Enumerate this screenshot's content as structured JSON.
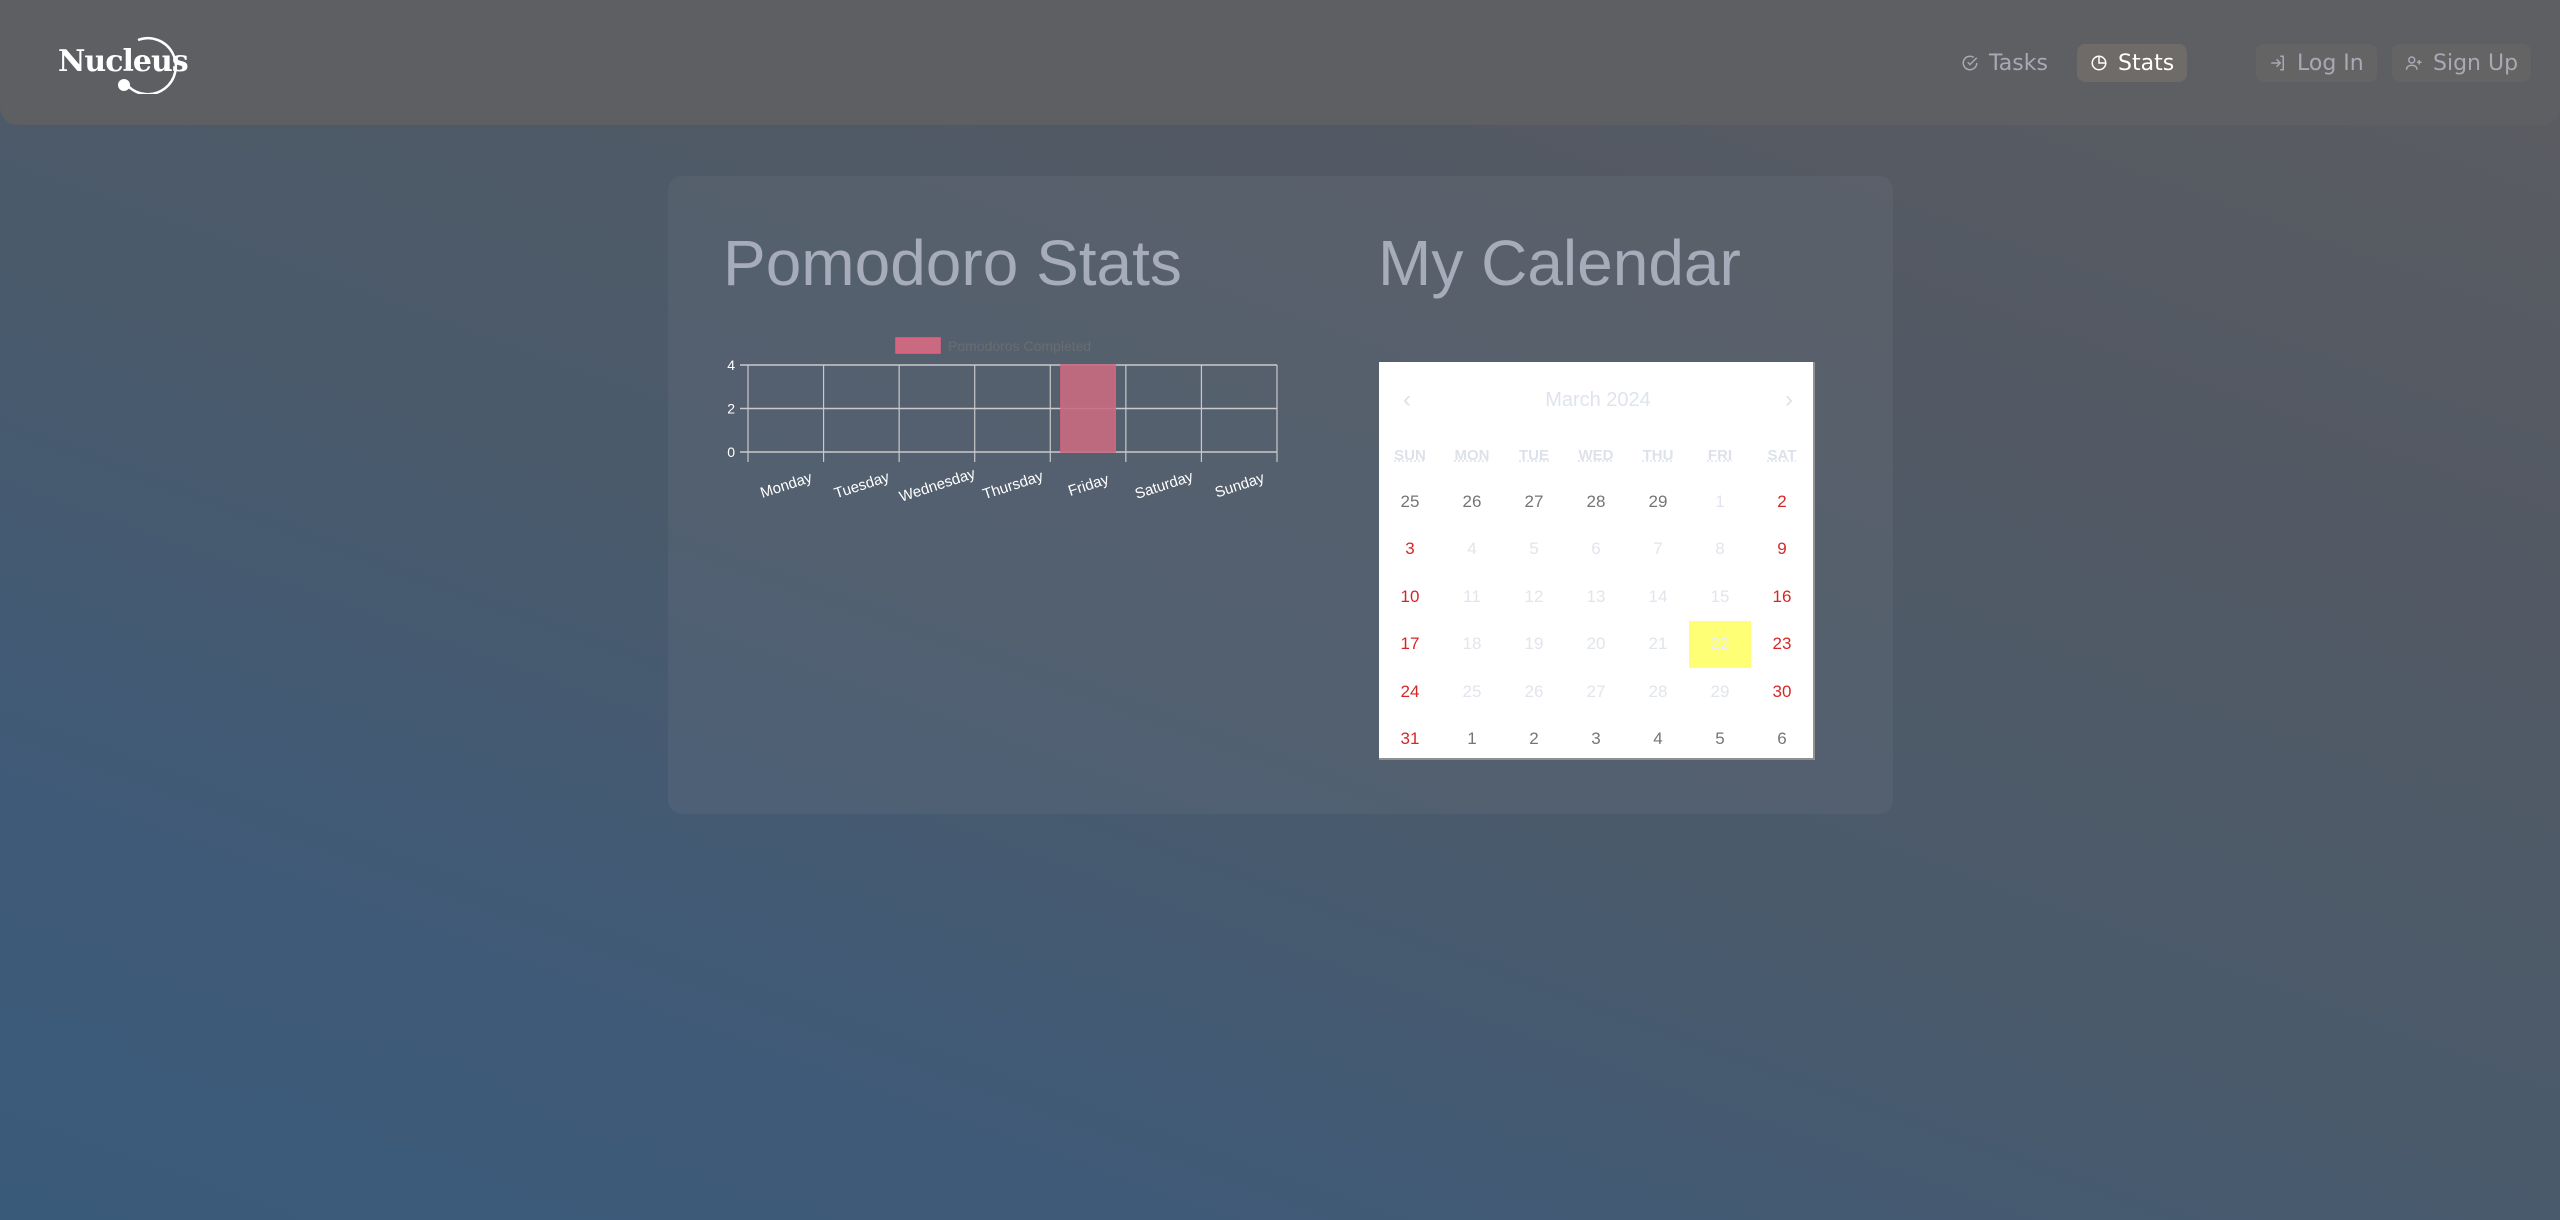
{
  "app": {
    "logo_text": "Nucleus"
  },
  "nav": {
    "tasks": {
      "label": "Tasks",
      "icon": "circle-check-icon"
    },
    "stats": {
      "label": "Stats",
      "icon": "pie-chart-icon",
      "active": true
    },
    "login": {
      "label": "Log In",
      "icon": "log-in-icon"
    },
    "signup": {
      "label": "Sign Up",
      "icon": "user-plus-icon"
    }
  },
  "stats_section": {
    "title": "Pomodoro Stats"
  },
  "calendar_section": {
    "title": "My Calendar",
    "month_label": "March 2024",
    "prev_label": "‹",
    "next_label": "›",
    "weekdays": [
      "SUN",
      "MON",
      "TUE",
      "WED",
      "THU",
      "FRI",
      "SAT"
    ],
    "weeks": [
      [
        {
          "d": "25",
          "t": "outside"
        },
        {
          "d": "26",
          "t": "outside"
        },
        {
          "d": "27",
          "t": "outside"
        },
        {
          "d": "28",
          "t": "outside"
        },
        {
          "d": "29",
          "t": "outside"
        },
        {
          "d": "1",
          "t": "faded"
        },
        {
          "d": "2",
          "t": "weekend"
        }
      ],
      [
        {
          "d": "3",
          "t": "weekend"
        },
        {
          "d": "4",
          "t": "faded"
        },
        {
          "d": "5",
          "t": "faded"
        },
        {
          "d": "6",
          "t": "faded"
        },
        {
          "d": "7",
          "t": "faded"
        },
        {
          "d": "8",
          "t": "faded"
        },
        {
          "d": "9",
          "t": "weekend"
        }
      ],
      [
        {
          "d": "10",
          "t": "weekend"
        },
        {
          "d": "11",
          "t": "faded"
        },
        {
          "d": "12",
          "t": "faded"
        },
        {
          "d": "13",
          "t": "faded"
        },
        {
          "d": "14",
          "t": "faded"
        },
        {
          "d": "15",
          "t": "faded"
        },
        {
          "d": "16",
          "t": "weekend"
        }
      ],
      [
        {
          "d": "17",
          "t": "weekend"
        },
        {
          "d": "18",
          "t": "faded"
        },
        {
          "d": "19",
          "t": "faded"
        },
        {
          "d": "20",
          "t": "faded"
        },
        {
          "d": "21",
          "t": "faded"
        },
        {
          "d": "22",
          "t": "today"
        },
        {
          "d": "23",
          "t": "weekend"
        }
      ],
      [
        {
          "d": "24",
          "t": "weekend"
        },
        {
          "d": "25",
          "t": "faded"
        },
        {
          "d": "26",
          "t": "faded"
        },
        {
          "d": "27",
          "t": "faded"
        },
        {
          "d": "28",
          "t": "faded"
        },
        {
          "d": "29",
          "t": "faded"
        },
        {
          "d": "30",
          "t": "weekend"
        }
      ],
      [
        {
          "d": "31",
          "t": "weekend"
        },
        {
          "d": "1",
          "t": "outside"
        },
        {
          "d": "2",
          "t": "outside"
        },
        {
          "d": "3",
          "t": "outside"
        },
        {
          "d": "4",
          "t": "outside"
        },
        {
          "d": "5",
          "t": "outside"
        },
        {
          "d": "6",
          "t": "outside"
        }
      ]
    ],
    "today_color": "#ffff76",
    "weekend_color": "#d10000"
  },
  "chart_data": {
    "type": "bar",
    "title": "",
    "categories": [
      "Monday",
      "Tuesday",
      "Wednesday",
      "Thursday",
      "Friday",
      "Saturday",
      "Sunday"
    ],
    "series": [
      {
        "name": "Pomodoros Completed",
        "values": [
          0,
          0,
          0,
          0,
          4,
          0,
          0
        ],
        "color": "#c96a80",
        "border": "#e5607e"
      }
    ],
    "xlabel": "",
    "ylabel": "",
    "ylim": [
      0,
      4
    ],
    "yticks": [
      0,
      2,
      4
    ],
    "grid": true,
    "legend": "top"
  }
}
